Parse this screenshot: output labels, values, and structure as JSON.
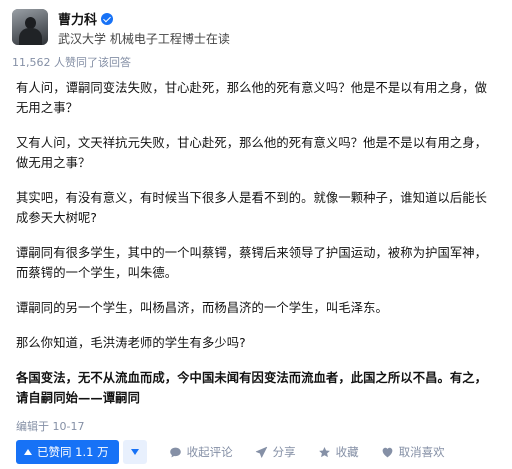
{
  "author": {
    "name": "曹力科",
    "headline": "武汉大学 机械电子工程博士在读"
  },
  "agree_meta": "11,562 人赞同了该回答",
  "paragraphs": [
    {
      "text": "有人问，谭嗣同变法失败，甘心赴死，那么他的死有意义吗？他是不是以有用之身，做无用之事？",
      "bold": false
    },
    {
      "text": "又有人问，文天祥抗元失败，甘心赴死，那么他的死有意义吗？他是不是以有用之身，做无用之事？",
      "bold": false
    },
    {
      "text": "其实吧，有没有意义，有时候当下很多人是看不到的。就像一颗种子，谁知道以后能长成参天大树呢?",
      "bold": false
    },
    {
      "text": "谭嗣同有很多学生，其中的一个叫蔡锷，蔡锷后来领导了护国运动，被称为护国军神，而蔡锷的一个学生，叫朱德。",
      "bold": false
    },
    {
      "text": "谭嗣同的另一个学生，叫杨昌济，而杨昌济的一个学生，叫毛泽东。",
      "bold": false
    },
    {
      "text": "那么你知道，毛洪涛老师的学生有多少吗?",
      "bold": false
    },
    {
      "text": "各国变法，无不从流血而成，今中国未闻有因变法而流血者，此国之所以不昌。有之，请自嗣同始——谭嗣同",
      "bold": true
    }
  ],
  "edited": "编辑于 10-17",
  "actions": {
    "agree_label": "已赞同 1.1 万",
    "collect_comments": "收起评论",
    "share": "分享",
    "favorite": "收藏",
    "like": "取消喜欢"
  },
  "colors": {
    "accent": "#1772f6",
    "meta": "#8590a6"
  },
  "icons": [
    "avatar",
    "verified-badge-icon",
    "caret-up-icon",
    "caret-down-icon",
    "comment-icon",
    "share-icon",
    "star-icon",
    "heart-icon"
  ]
}
